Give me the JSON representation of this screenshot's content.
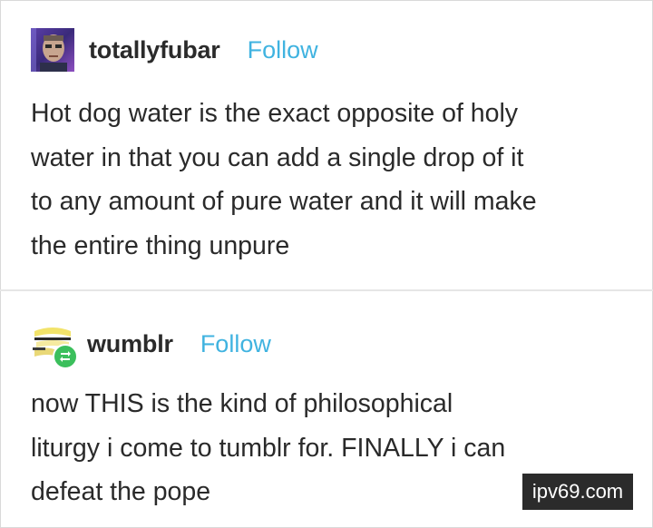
{
  "posts": [
    {
      "username": "totallyfubar",
      "follow_label": "Follow",
      "avatar_icon": "user-photo-avatar",
      "lines": [
        "Hot dog water is the exact opposite of holy",
        "water in that you can add a single drop of it",
        "to any amount of pure water and it will make",
        "the entire thing unpure"
      ]
    },
    {
      "username": "wumblr",
      "follow_label": "Follow",
      "avatar_icon": "user-avatar-with-reblog-badge",
      "lines": [
        "now THIS is the kind of philosophical",
        "liturgy i come to tumblr for. FINALLY i can",
        "defeat the pope"
      ]
    }
  ],
  "watermark": "ipv69.com",
  "colors": {
    "follow": "#40b3e0",
    "reblog_badge": "#3bbf5c",
    "divider": "#e6e6e6"
  }
}
